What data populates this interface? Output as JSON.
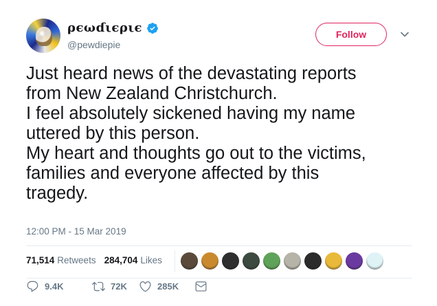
{
  "user": {
    "display_name": "ρєωɗιєριє",
    "handle": "@pewdiepie",
    "verified": true
  },
  "follow_button": {
    "label": "Follow",
    "color": "#e0245e"
  },
  "tweet": {
    "lines": [
      "Just heard news of the devastating reports",
      "from New Zealand Christchurch.",
      "I feel absolutely sickened having my name",
      "uttered by this person.",
      "My heart and thoughts go out to the victims,",
      "families and everyone affected by this",
      "tragedy."
    ],
    "timestamp": "12:00 PM - 15 Mar 2019"
  },
  "stats": {
    "retweets_count": "71,514",
    "retweets_label": "Retweets",
    "likes_count": "284,704",
    "likes_label": "Likes"
  },
  "likers": [
    {
      "color": "#5b4a3a"
    },
    {
      "color": "#c98a2e"
    },
    {
      "color": "#2f2f2f"
    },
    {
      "color": "#3d4a3f"
    },
    {
      "color": "#5fa35a"
    },
    {
      "color": "#b6b3a8"
    },
    {
      "color": "#2b2b2b"
    },
    {
      "color": "#e9b93a"
    },
    {
      "color": "#6a3aa1"
    },
    {
      "color": "#dff3f7"
    }
  ],
  "actions": {
    "replies": "9.4K",
    "retweets": "72K",
    "likes": "285K"
  },
  "colors": {
    "text": "#14171a",
    "muted": "#657786",
    "verified": "#1da1f2"
  }
}
